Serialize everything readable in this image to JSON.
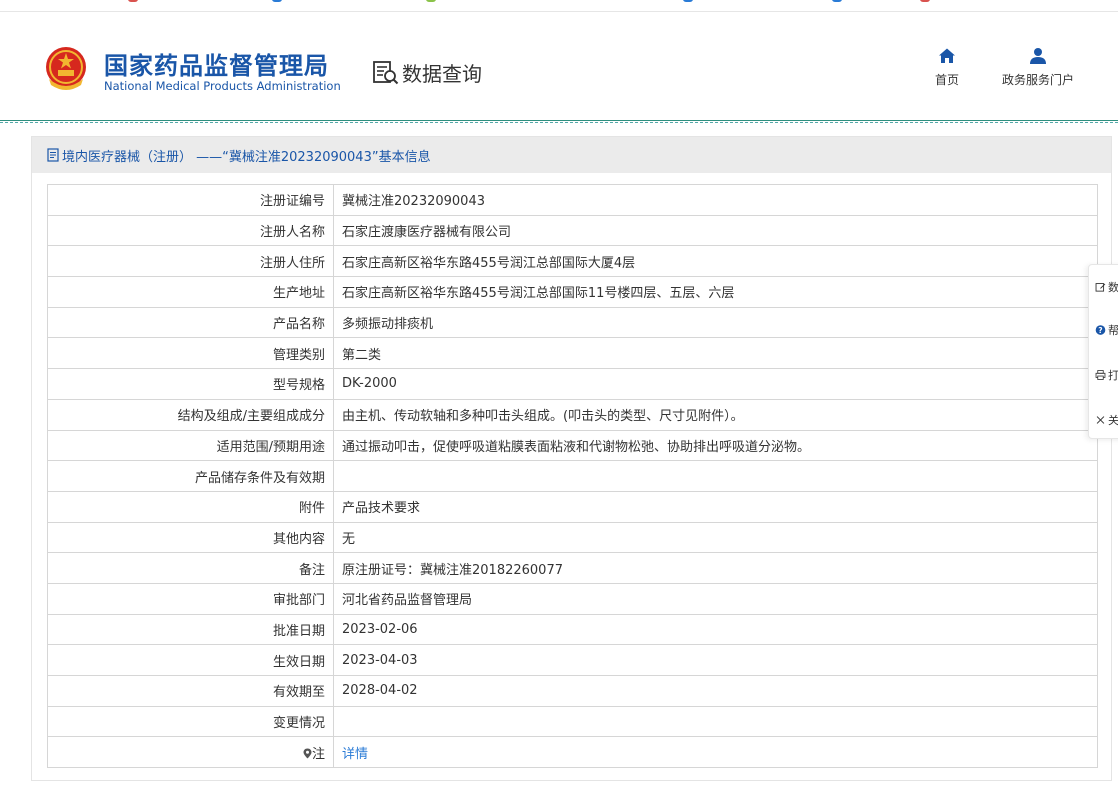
{
  "header": {
    "logo_cn": "国家药品监督管理局",
    "logo_en": "National Medical Products Administration",
    "data_query": "数据查询",
    "nav_home": "首页",
    "nav_gov": "政务服务门户"
  },
  "panel": {
    "title": "境内医疗器械（注册） ——“冀械注准20232090043”基本信息"
  },
  "rows": [
    {
      "label": "注册证编号",
      "value": "冀械注准20232090043"
    },
    {
      "label": "注册人名称",
      "value": "石家庄渡康医疗器械有限公司"
    },
    {
      "label": "注册人住所",
      "value": "石家庄高新区裕华东路455号润江总部国际大厦4层"
    },
    {
      "label": "生产地址",
      "value": "石家庄高新区裕华东路455号润江总部国际11号楼四层、五层、六层"
    },
    {
      "label": "产品名称",
      "value": "多频振动排痰机"
    },
    {
      "label": "管理类别",
      "value": "第二类"
    },
    {
      "label": "型号规格",
      "value": "DK-2000"
    },
    {
      "label": "结构及组成/主要组成成分",
      "value": "由主机、传动软轴和多种叩击头组成。(叩击头的类型、尺寸见附件）。"
    },
    {
      "label": "适用范围/预期用途",
      "value": "通过振动叩击，促使呼吸道粘膜表面粘液和代谢物松弛、协助排出呼吸道分泌物。"
    },
    {
      "label": "产品储存条件及有效期",
      "value": ""
    },
    {
      "label": "附件",
      "value": "产品技术要求"
    },
    {
      "label": "其他内容",
      "value": "无"
    },
    {
      "label": "备注",
      "value": "原注册证号：冀械注准20182260077"
    },
    {
      "label": "审批部门",
      "value": "河北省药品监督管理局"
    },
    {
      "label": "批准日期",
      "value": "2023-02-06"
    },
    {
      "label": "生效日期",
      "value": "2023-04-03"
    },
    {
      "label": "有效期至",
      "value": "2028-04-02"
    },
    {
      "label": "变更情况",
      "value": ""
    },
    {
      "label": "注",
      "value": "详情"
    }
  ],
  "sidebar": {
    "items": [
      {
        "label": "数",
        "icon": "edit-icon"
      },
      {
        "label": "帮",
        "icon": "help-icon"
      },
      {
        "label": "打",
        "icon": "print-icon"
      },
      {
        "label": "关",
        "icon": "close-icon"
      }
    ]
  },
  "colors": {
    "brand": "#1a56a8",
    "link": "#2a7bd6",
    "divider": "#2f8e7e",
    "panel_head_bg": "#ebebeb"
  }
}
